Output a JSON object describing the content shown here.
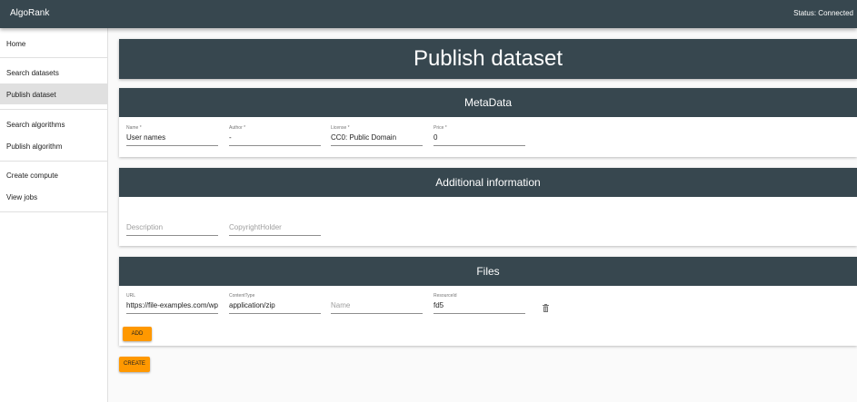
{
  "app": {
    "title": "AlgoRank",
    "status": "Status: Connected"
  },
  "sidebar": {
    "items": [
      {
        "label": "Home"
      },
      {
        "label": "Search datasets"
      },
      {
        "label": "Publish dataset"
      },
      {
        "label": "Search algorithms"
      },
      {
        "label": "Publish algorithm"
      },
      {
        "label": "Create compute"
      },
      {
        "label": "View jobs"
      }
    ],
    "active": "Publish dataset"
  },
  "page": {
    "title": "Publish dataset"
  },
  "metadata": {
    "header": "MetaData",
    "fields": {
      "name": {
        "label": "Name *",
        "value": "User names"
      },
      "author": {
        "label": "Author *",
        "value": "-"
      },
      "license": {
        "label": "License *",
        "value": "CC0: Public Domain"
      },
      "price": {
        "label": "Price *",
        "value": "0"
      }
    }
  },
  "additional": {
    "header": "Additional information",
    "fields": {
      "description": {
        "placeholder": "Description"
      },
      "copyright": {
        "placeholder": "CopyrightHolder"
      }
    }
  },
  "files": {
    "header": "Files",
    "fields": {
      "url": {
        "label": "URL",
        "value": "https://file-examples.com/wp"
      },
      "content_type": {
        "label": "ContentType",
        "value": "application/zip"
      },
      "name": {
        "placeholder": "Name"
      },
      "resource_id": {
        "label": "ResourceId",
        "value": "fd5"
      }
    },
    "add_label": "ADD",
    "delete_icon": "trash-icon"
  },
  "actions": {
    "create_label": "CREATE"
  },
  "colors": {
    "appbar": "#37474f",
    "accent": "#ff9800",
    "active_nav": "#e0e0e0"
  }
}
